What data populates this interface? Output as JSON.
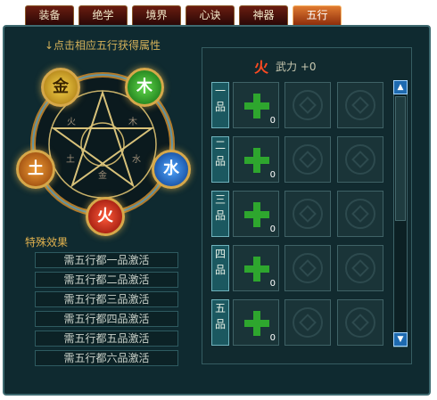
{
  "tabs": [
    "装备",
    "绝学",
    "境界",
    "心诀",
    "神器",
    "五行"
  ],
  "active_tab": "五行",
  "hint": "↓点击相应五行获得属性",
  "elements": {
    "metal": "金",
    "wood": "木",
    "water": "水",
    "fire": "火",
    "earth": "土"
  },
  "wheel_runes": [
    "火",
    "木",
    "土",
    "水",
    "金"
  ],
  "special_effects": {
    "title": "特殊效果",
    "rows": [
      "需五行都一品激活",
      "需五行都二品激活",
      "需五行都三品激活",
      "需五行都四品激活",
      "需五行都五品激活",
      "需五行都六品激活"
    ]
  },
  "selected": {
    "element": "火",
    "stat": "武力 +0"
  },
  "grades": [
    {
      "label": [
        "一",
        "品"
      ],
      "count": "0"
    },
    {
      "label": [
        "二",
        "品"
      ],
      "count": "0"
    },
    {
      "label": [
        "三",
        "品"
      ],
      "count": "0"
    },
    {
      "label": [
        "四",
        "品"
      ],
      "count": "0"
    },
    {
      "label": [
        "五",
        "品"
      ],
      "count": "0"
    }
  ],
  "colors": {
    "accent": "#d4b15a",
    "fire": "#ff4a22",
    "plus": "#2ea62e",
    "panel_bg": "#0f2a30"
  }
}
